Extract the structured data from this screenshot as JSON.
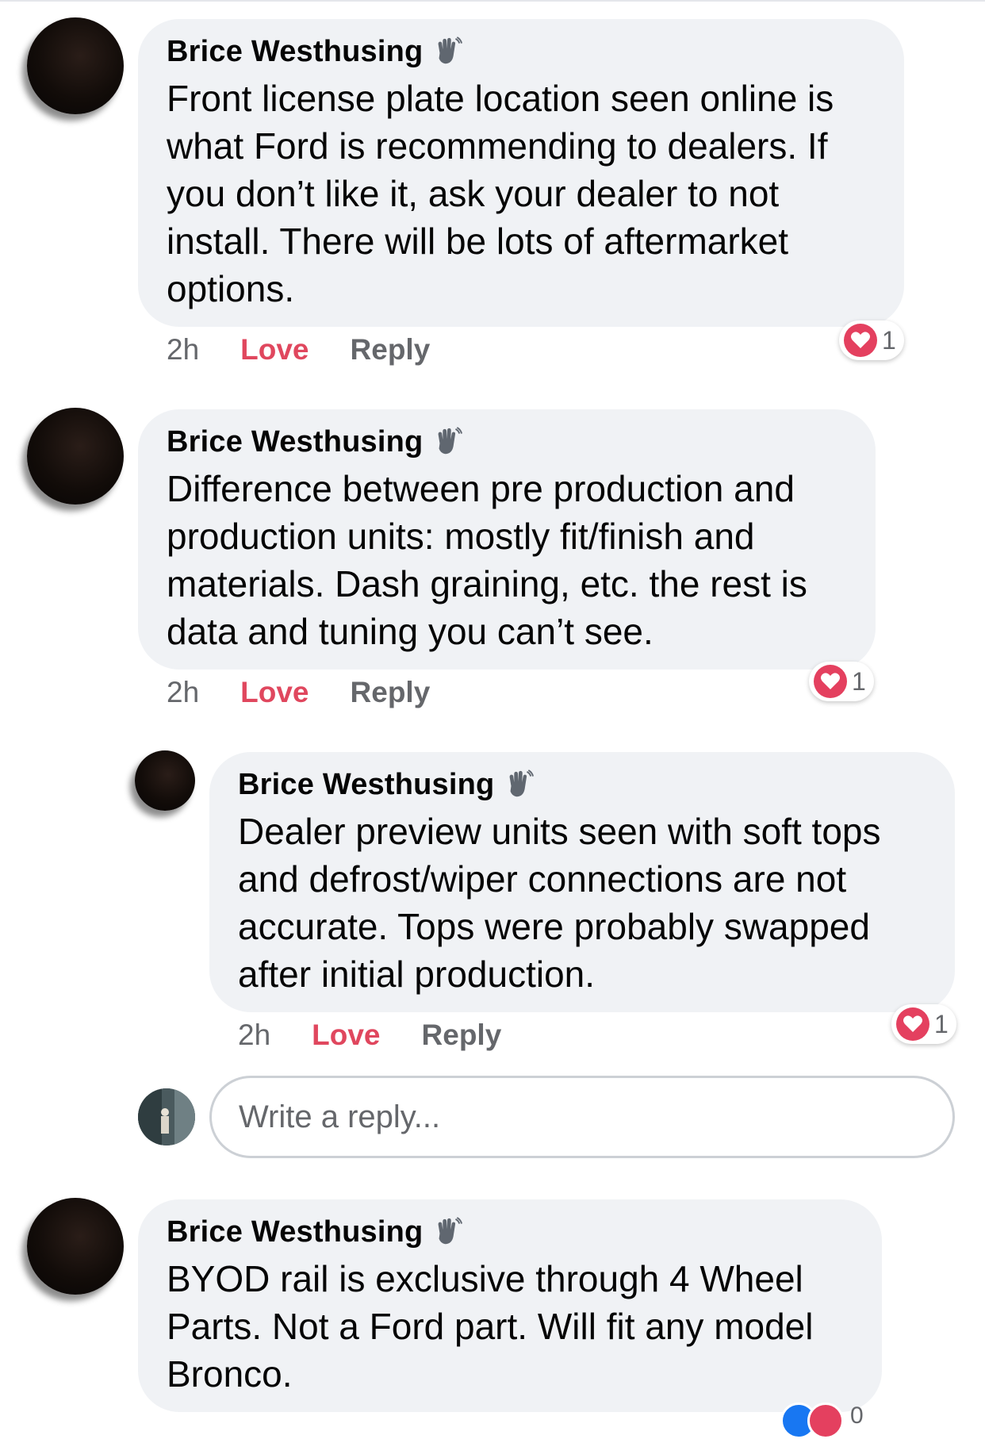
{
  "comments": [
    {
      "author": "Brice Westhusing",
      "text": "Front license plate location seen online is\nwhat Ford is recommending to dealers. If\nyou don’t like it, ask your dealer to not\ninstall. There will be lots of aftermarket\noptions.",
      "time": "2h",
      "love_label": "Love",
      "reply_label": "Reply",
      "reaction_count": "1"
    },
    {
      "author": "Brice Westhusing",
      "text": "Difference between pre production and\nproduction units: mostly fit/finish and\nmaterials. Dash graining, etc. the rest is\ndata and tuning you can’t see.",
      "time": "2h",
      "love_label": "Love",
      "reply_label": "Reply",
      "reaction_count": "1"
    },
    {
      "author": "Brice Westhusing",
      "text": "Dealer preview units seen with soft tops\nand defrost/wiper connections are not\naccurate. Tops were probably swapped\nafter initial production.",
      "time": "2h",
      "love_label": "Love",
      "reply_label": "Reply",
      "reaction_count": "1"
    },
    {
      "author": "Brice Westhusing",
      "text": "BYOD rail is exclusive through 4 Wheel\nParts. Not a Ford part. Will fit any model\nBronco.",
      "reaction_count": "0"
    }
  ],
  "reply_input": {
    "placeholder": "Write a reply..."
  },
  "colors": {
    "bubble": "#f0f2f5",
    "love": "#e0475e",
    "muted": "#65676b",
    "heart": "#e4405f",
    "like": "#1877f2"
  },
  "icons": [
    "waving-hand-icon",
    "heart-icon",
    "like-icon"
  ]
}
